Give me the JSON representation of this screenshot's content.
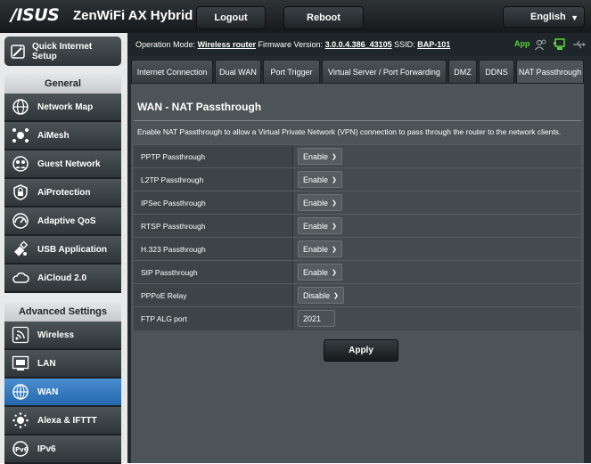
{
  "header": {
    "logo": "/ISUS",
    "model": "ZenWiFi AX Hybrid",
    "logout_label": "Logout",
    "reboot_label": "Reboot",
    "language_label": "English"
  },
  "sidebar": {
    "quick_setup_label": "Quick Internet Setup",
    "general_header": "General",
    "general_items": [
      {
        "label": "Network Map",
        "icon": "globe-icon"
      },
      {
        "label": "AiMesh",
        "icon": "mesh-icon"
      },
      {
        "label": "Guest Network",
        "icon": "guest-network-icon"
      },
      {
        "label": "AiProtection",
        "icon": "lock-shield-icon"
      },
      {
        "label": "Adaptive QoS",
        "icon": "gauge-icon"
      },
      {
        "label": "USB Application",
        "icon": "usb-icon"
      },
      {
        "label": "AiCloud 2.0",
        "icon": "cloud-icon"
      }
    ],
    "advanced_header": "Advanced Settings",
    "advanced_items": [
      {
        "label": "Wireless",
        "icon": "wifi-icon"
      },
      {
        "label": "LAN",
        "icon": "lan-icon"
      },
      {
        "label": "WAN",
        "icon": "wan-globe-icon"
      },
      {
        "label": "Alexa & IFTTT",
        "icon": "alexa-icon"
      },
      {
        "label": "IPv6",
        "icon": "ipv6-icon"
      }
    ]
  },
  "status_bar": {
    "op_mode_label": "Operation Mode:",
    "op_mode_value": "Wireless router",
    "firmware_label": "Firmware Version:",
    "firmware_value": "3.0.0.4.386_43105",
    "ssid_label": "SSID:",
    "ssid_value": "BAP-101",
    "app_label": "App"
  },
  "tabs": [
    {
      "label": "Internet Connection"
    },
    {
      "label": "Dual WAN"
    },
    {
      "label": "Port Trigger"
    },
    {
      "label": "Virtual Server / Port Forwarding"
    },
    {
      "label": "DMZ"
    },
    {
      "label": "DDNS"
    },
    {
      "label": "NAT Passthrough"
    }
  ],
  "page": {
    "title": "WAN - NAT Passthrough",
    "description": "Enable NAT Passthrough to allow a Virtual Private Network (VPN) connection to pass through the router to the network clients."
  },
  "settings": [
    {
      "label": "PPTP Passthrough",
      "value": "Enable"
    },
    {
      "label": "L2TP Passthrough",
      "value": "Enable"
    },
    {
      "label": "IPSec Passthrough",
      "value": "Enable"
    },
    {
      "label": "RTSP Passthrough",
      "value": "Enable"
    },
    {
      "label": "H.323 Passthrough",
      "value": "Enable"
    },
    {
      "label": "SIP Passthrough",
      "value": "Enable"
    },
    {
      "label": "PPPoE Relay",
      "value": "Disable"
    }
  ],
  "ftp_alg": {
    "label": "FTP ALG port",
    "value": "2021"
  },
  "apply_label": "Apply",
  "colors": {
    "accent_active": "#2f75bb",
    "app_green": "#5ad33a"
  }
}
